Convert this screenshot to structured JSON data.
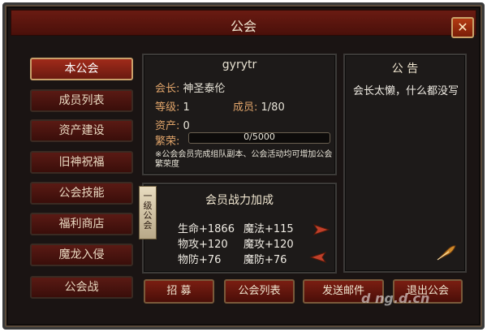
{
  "window": {
    "title": "公会",
    "close_icon": "close-icon"
  },
  "sidebar": {
    "items": [
      {
        "label": "本公会",
        "active": true
      },
      {
        "label": "成员列表",
        "active": false
      },
      {
        "label": "资产建设",
        "active": false
      },
      {
        "label": "旧神祝福",
        "active": false
      },
      {
        "label": "公会技能",
        "active": false
      },
      {
        "label": "福利商店",
        "active": false
      },
      {
        "label": "魔龙入侵",
        "active": false
      },
      {
        "label": "公会战",
        "active": false
      }
    ]
  },
  "guild": {
    "name": "gyrytr",
    "leader_label": "会长:",
    "leader": "神圣泰伦",
    "level_label": "等级:",
    "level": "1",
    "members_label": "成员:",
    "members": "1/80",
    "assets_label": "资产:",
    "assets": "0",
    "prosperity_label": "繁荣:",
    "prosperity": "0/5000",
    "prosperity_progress": 0,
    "note": "※公会会员完成组队副本、公会活动均可增加公会繁荣度"
  },
  "notice": {
    "title": "公 告",
    "body": "会长太懒，什么都没写",
    "icon": "feather-quill-icon"
  },
  "bonus": {
    "title": "会员战力加成",
    "ribbon": "一级公会",
    "stats": [
      [
        "生命+1866",
        "魔法+115"
      ],
      [
        "物攻+120",
        "魔攻+120"
      ],
      [
        "物防+76",
        "魔防+76"
      ]
    ]
  },
  "buttons": {
    "recruit": "招 募",
    "guild_list": "公会列表",
    "send_mail": "发送邮件",
    "leave": "退出公会"
  },
  "watermark": "d ng.d.cn",
  "colors": {
    "accent": "#c9a06a",
    "label": "#e0a46a",
    "active": "#a02a1a"
  }
}
